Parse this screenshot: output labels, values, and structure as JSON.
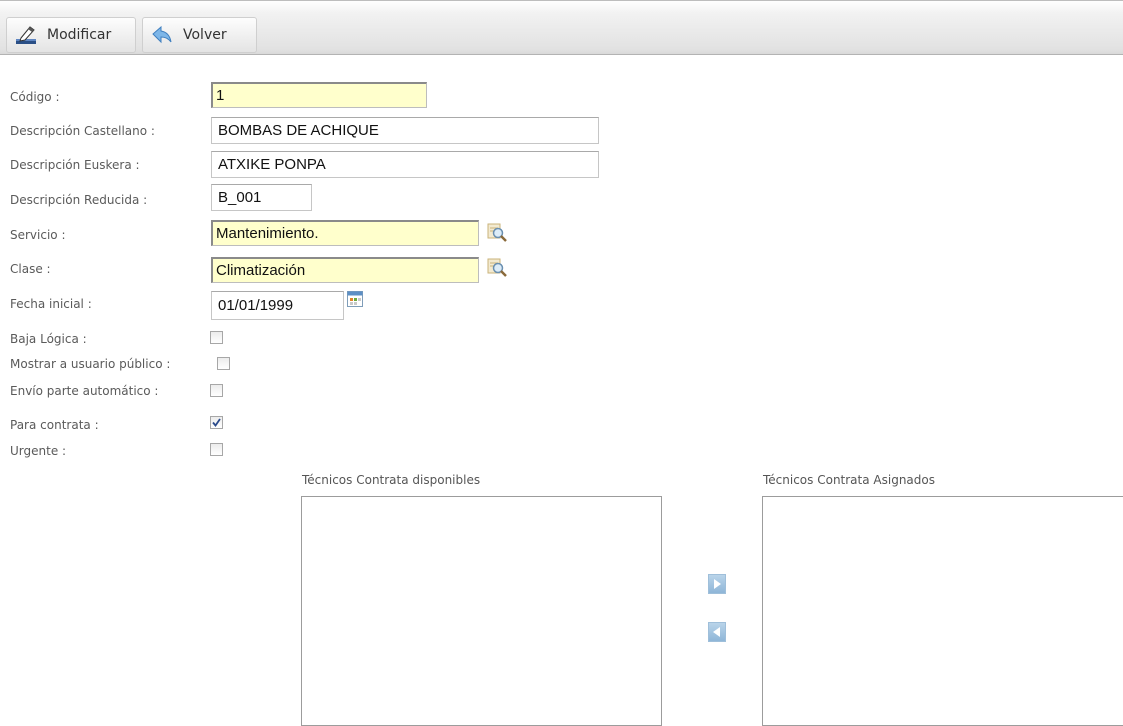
{
  "toolbar": {
    "modify_label": "Modificar",
    "back_label": "Volver"
  },
  "form": {
    "codigo": {
      "label": "Código :",
      "value": "1"
    },
    "desc_castellano": {
      "label": "Descripción Castellano :",
      "value": "BOMBAS DE ACHIQUE"
    },
    "desc_euskera": {
      "label": "Descripción Euskera :",
      "value": "ATXIKE PONPA"
    },
    "desc_reducida": {
      "label": "Descripción Reducida :",
      "value": "B_001"
    },
    "servicio": {
      "label": "Servicio :",
      "value": "Mantenimiento."
    },
    "clase": {
      "label": "Clase :",
      "value": "Climatización"
    },
    "fecha_inicial": {
      "label": "Fecha inicial :",
      "value": "01/01/1999"
    },
    "baja_logica": {
      "label": "Baja Lógica :",
      "checked": false
    },
    "mostrar_usuario": {
      "label": "Mostrar a usuario público :",
      "checked": false
    },
    "envio_parte": {
      "label": "Envío parte automático :",
      "checked": false
    },
    "para_contrata": {
      "label": "Para contrata :",
      "checked": true
    },
    "urgente": {
      "label": "Urgente :",
      "checked": false
    }
  },
  "lists": {
    "available_title": "Técnicos Contrata disponibles",
    "assigned_title": "Técnicos Contrata Asignados",
    "available_items": [],
    "assigned_items": []
  },
  "colors": {
    "required_field_bg": "#ffffcc",
    "arrow_button": "#9fc1df"
  },
  "icons": {
    "modify": "edit-pencil-icon",
    "back": "back-arrow-icon",
    "lookup": "magnifier-icon",
    "calendar": "calendar-icon",
    "move_right": "arrow-right-icon",
    "move_left": "arrow-left-icon"
  }
}
